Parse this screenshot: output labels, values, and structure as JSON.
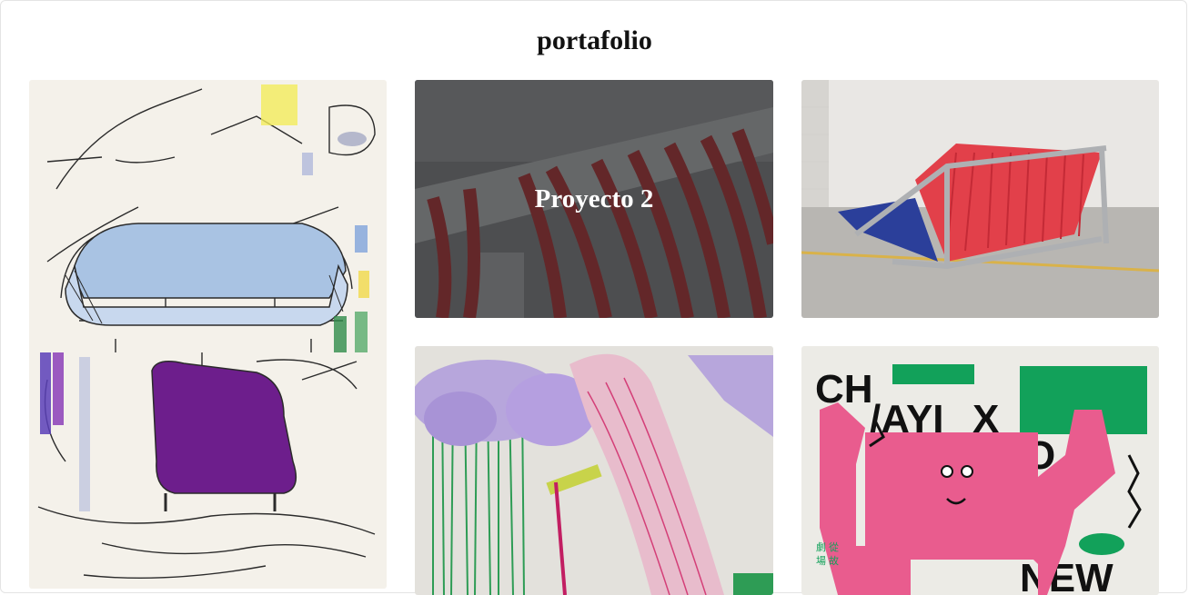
{
  "page": {
    "title": "portafolio"
  },
  "projects": [
    {
      "caption": ""
    },
    {
      "caption": "Proyecto 2"
    },
    {
      "caption": ""
    },
    {
      "caption": ""
    },
    {
      "caption": ""
    }
  ],
  "colors": {
    "background": "#ffffff",
    "overlay": "rgba(40,40,40,0.62)",
    "pink": "#e95c8e",
    "green": "#12a15a",
    "purple": "#6d1e8c"
  },
  "icons": [
    "sofa-sketch-image",
    "red-rope-chair-image",
    "inflatable-chair-image",
    "textile-sculpture-image",
    "poster-image"
  ]
}
